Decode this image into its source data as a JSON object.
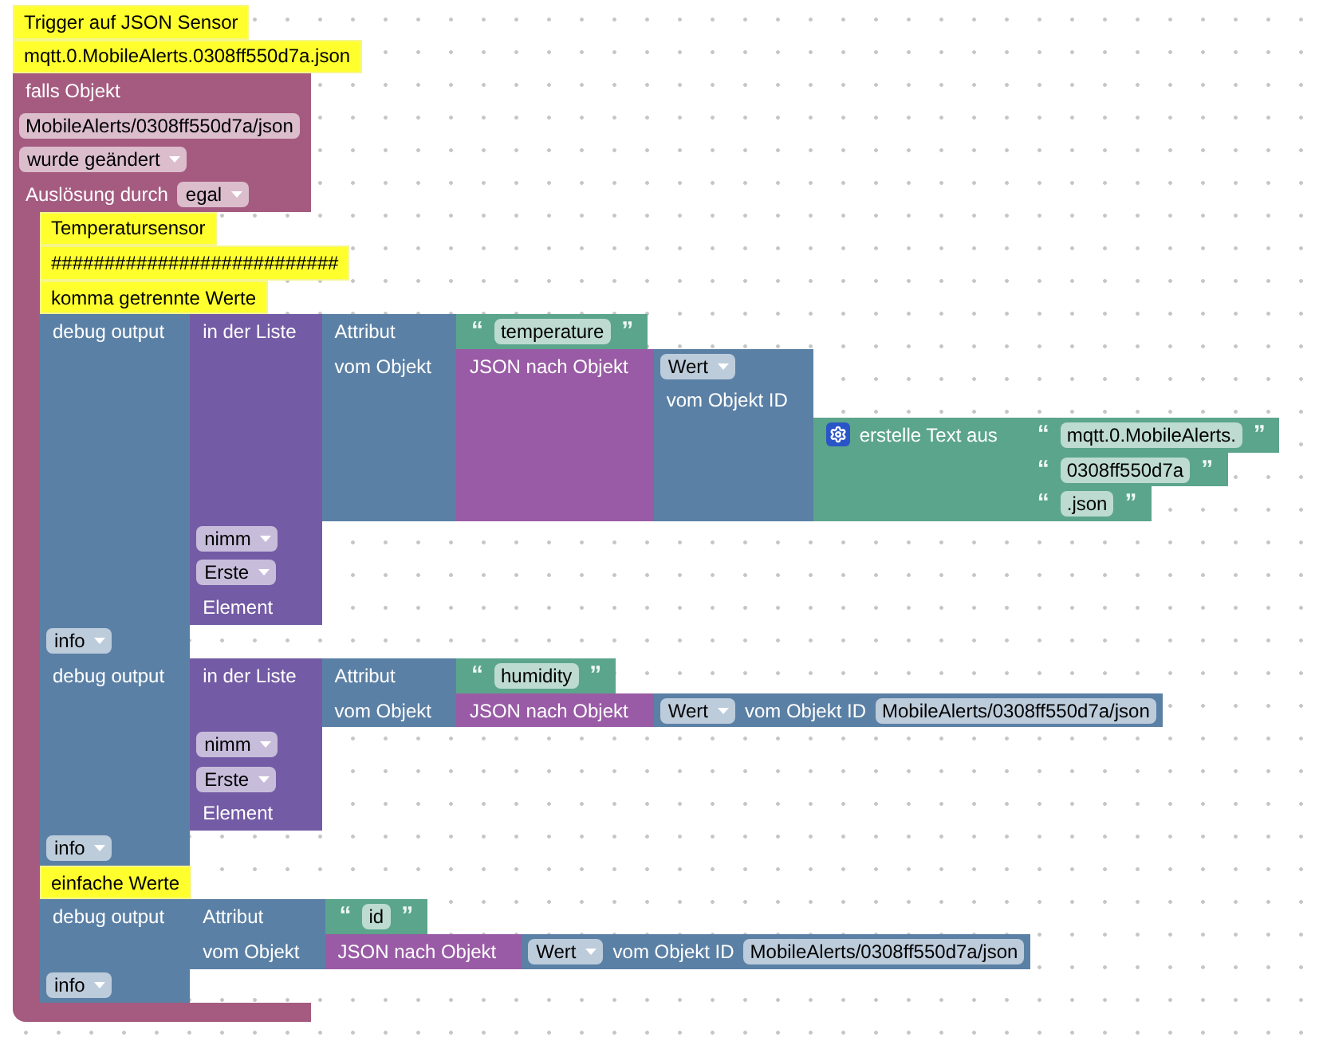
{
  "workspace": {
    "stack": [
      {
        "kind": "comment",
        "text": "Trigger auf JSON Sensor"
      },
      {
        "kind": "comment",
        "text": "mqtt.0.MobileAlerts.0308ff550d7a.json"
      },
      {
        "kind": "event",
        "rows": [
          {
            "fields": [
              {
                "kind": "label",
                "text": "falls Objekt"
              }
            ]
          },
          {
            "fields": [
              {
                "kind": "input",
                "text": "MobileAlerts/0308ff550d7a/json"
              }
            ]
          },
          {
            "fields": [
              {
                "kind": "dropdown",
                "text": "wurde geändert"
              }
            ]
          },
          {
            "fields": [
              {
                "kind": "label",
                "text": "Auslösung durch"
              },
              {
                "kind": "dropdown",
                "text": "egal"
              }
            ]
          }
        ],
        "statements": [
          {
            "kind": "comment",
            "text": "Temperatursensor"
          },
          {
            "kind": "comment",
            "text": "###########################"
          },
          {
            "kind": "comment",
            "text": "komma getrennte Werte"
          },
          {
            "kind": "debug",
            "rows": [
              {
                "fields": [
                  {
                    "kind": "label",
                    "text": "debug output"
                  }
                ],
                "input": {
                  "kind": "lists",
                  "rows": [
                    {
                      "fields": [
                        {
                          "kind": "label",
                          "text": "in der Liste"
                        }
                      ],
                      "input": {
                        "kind": "object",
                        "rows": [
                          {
                            "fields": [
                              {
                                "kind": "label",
                                "text": "Attribut"
                              }
                            ],
                            "input": {
                              "kind": "text",
                              "rows": [
                                {
                                  "fields": [
                                    {
                                      "kind": "quote",
                                      "text": "“"
                                    },
                                    {
                                      "kind": "input",
                                      "text": "temperature"
                                    },
                                    {
                                      "kind": "quote",
                                      "text": "”"
                                    }
                                  ]
                                }
                              ]
                            }
                          },
                          {
                            "fields": [
                              {
                                "kind": "label",
                                "text": "vom Objekt"
                              }
                            ],
                            "input": {
                              "kind": "convert",
                              "rows": [
                                {
                                  "fields": [
                                    {
                                      "kind": "label",
                                      "text": "JSON nach Objekt"
                                    }
                                  ],
                                  "input": {
                                    "kind": "state",
                                    "rows": [
                                      {
                                        "fields": [
                                          {
                                            "kind": "dropdown",
                                            "text": "Wert"
                                          }
                                        ]
                                      },
                                      {
                                        "fields": [
                                          {
                                            "kind": "label",
                                            "text": "vom Objekt ID"
                                          }
                                        ]
                                      },
                                      {
                                        "input": {
                                          "kind": "join",
                                          "rows": [
                                            {
                                              "fields": [
                                                {
                                                  "kind": "mutator"
                                                },
                                                {
                                                  "kind": "label",
                                                  "text": "erstelle Text aus"
                                                }
                                              ],
                                              "input": {
                                                "kind": "text",
                                                "rows": [
                                                  {
                                                    "fields": [
                                                      {
                                                        "kind": "quote",
                                                        "text": "“"
                                                      },
                                                      {
                                                        "kind": "input",
                                                        "text": "mqtt.0.MobileAlerts."
                                                      },
                                                      {
                                                        "kind": "quote",
                                                        "text": "”"
                                                      }
                                                    ]
                                                  }
                                                ]
                                              }
                                            },
                                            {
                                              "input": {
                                                "kind": "text",
                                                "rows": [
                                                  {
                                                    "fields": [
                                                      {
                                                        "kind": "quote",
                                                        "text": "“"
                                                      },
                                                      {
                                                        "kind": "input",
                                                        "text": "0308ff550d7a"
                                                      },
                                                      {
                                                        "kind": "quote",
                                                        "text": "”"
                                                      }
                                                    ]
                                                  }
                                                ]
                                              }
                                            },
                                            {
                                              "input": {
                                                "kind": "text",
                                                "rows": [
                                                  {
                                                    "fields": [
                                                      {
                                                        "kind": "quote",
                                                        "text": "“"
                                                      },
                                                      {
                                                        "kind": "input",
                                                        "text": ".json"
                                                      },
                                                      {
                                                        "kind": "quote",
                                                        "text": "”"
                                                      }
                                                    ]
                                                  }
                                                ]
                                              }
                                            }
                                          ]
                                        }
                                      }
                                    ]
                                  }
                                }
                              ]
                            }
                          }
                        ]
                      }
                    },
                    {
                      "fields": [
                        {
                          "kind": "dropdown",
                          "text": "nimm"
                        }
                      ]
                    },
                    {
                      "fields": [
                        {
                          "kind": "dropdown",
                          "text": "Erste"
                        }
                      ]
                    },
                    {
                      "fields": [
                        {
                          "kind": "label",
                          "text": "Element"
                        }
                      ]
                    }
                  ]
                }
              },
              {
                "fields": [
                  {
                    "kind": "dropdown",
                    "text": "info"
                  }
                ]
              }
            ]
          },
          {
            "kind": "debug",
            "rows": [
              {
                "fields": [
                  {
                    "kind": "label",
                    "text": "debug output"
                  }
                ],
                "input": {
                  "kind": "lists",
                  "rows": [
                    {
                      "fields": [
                        {
                          "kind": "label",
                          "text": "in der Liste"
                        }
                      ],
                      "input": {
                        "kind": "object",
                        "rows": [
                          {
                            "fields": [
                              {
                                "kind": "label",
                                "text": "Attribut"
                              }
                            ],
                            "input": {
                              "kind": "text",
                              "rows": [
                                {
                                  "fields": [
                                    {
                                      "kind": "quote",
                                      "text": "“"
                                    },
                                    {
                                      "kind": "input",
                                      "text": "humidity"
                                    },
                                    {
                                      "kind": "quote",
                                      "text": "”"
                                    }
                                  ]
                                }
                              ]
                            }
                          },
                          {
                            "fields": [
                              {
                                "kind": "label",
                                "text": "vom Objekt"
                              }
                            ],
                            "input": {
                              "kind": "convert",
                              "rows": [
                                {
                                  "fields": [
                                    {
                                      "kind": "label",
                                      "text": "JSON nach Objekt"
                                    }
                                  ],
                                  "input": {
                                    "kind": "state",
                                    "rows": [
                                      {
                                        "fields": [
                                          {
                                            "kind": "dropdown",
                                            "text": "Wert"
                                          },
                                          {
                                            "kind": "label",
                                            "text": "vom Objekt ID"
                                          },
                                          {
                                            "kind": "input",
                                            "text": "MobileAlerts/0308ff550d7a/json"
                                          }
                                        ]
                                      }
                                    ]
                                  }
                                }
                              ]
                            }
                          }
                        ]
                      }
                    },
                    {
                      "fields": [
                        {
                          "kind": "dropdown",
                          "text": "nimm"
                        }
                      ]
                    },
                    {
                      "fields": [
                        {
                          "kind": "dropdown",
                          "text": "Erste"
                        }
                      ]
                    },
                    {
                      "fields": [
                        {
                          "kind": "label",
                          "text": "Element"
                        }
                      ]
                    }
                  ]
                }
              },
              {
                "fields": [
                  {
                    "kind": "dropdown",
                    "text": "info"
                  }
                ]
              }
            ]
          },
          {
            "kind": "comment",
            "text": "einfache Werte"
          },
          {
            "kind": "debug",
            "rows": [
              {
                "fields": [
                  {
                    "kind": "label",
                    "text": "debug output"
                  }
                ],
                "input": {
                  "kind": "object",
                  "rows": [
                    {
                      "fields": [
                        {
                          "kind": "label",
                          "text": "Attribut"
                        }
                      ],
                      "input": {
                        "kind": "text",
                        "rows": [
                          {
                            "fields": [
                              {
                                "kind": "quote",
                                "text": "“"
                              },
                              {
                                "kind": "input",
                                "text": "id"
                              },
                              {
                                "kind": "quote",
                                "text": "”"
                              }
                            ]
                          }
                        ]
                      }
                    },
                    {
                      "fields": [
                        {
                          "kind": "label",
                          "text": "vom Objekt"
                        }
                      ],
                      "input": {
                        "kind": "convert",
                        "rows": [
                          {
                            "fields": [
                              {
                                "kind": "label",
                                "text": "JSON nach Objekt"
                              }
                            ],
                            "input": {
                              "kind": "state",
                              "rows": [
                                {
                                  "fields": [
                                    {
                                      "kind": "dropdown",
                                      "text": "Wert"
                                    },
                                    {
                                      "kind": "label",
                                      "text": "vom Objekt ID"
                                    },
                                    {
                                      "kind": "input",
                                      "text": "MobileAlerts/0308ff550d7a/json"
                                    }
                                  ]
                                }
                              ]
                            }
                          }
                        ]
                      }
                    }
                  ]
                }
              },
              {
                "fields": [
                  {
                    "kind": "dropdown",
                    "text": "info"
                  }
                ]
              }
            ]
          }
        ]
      }
    ]
  }
}
